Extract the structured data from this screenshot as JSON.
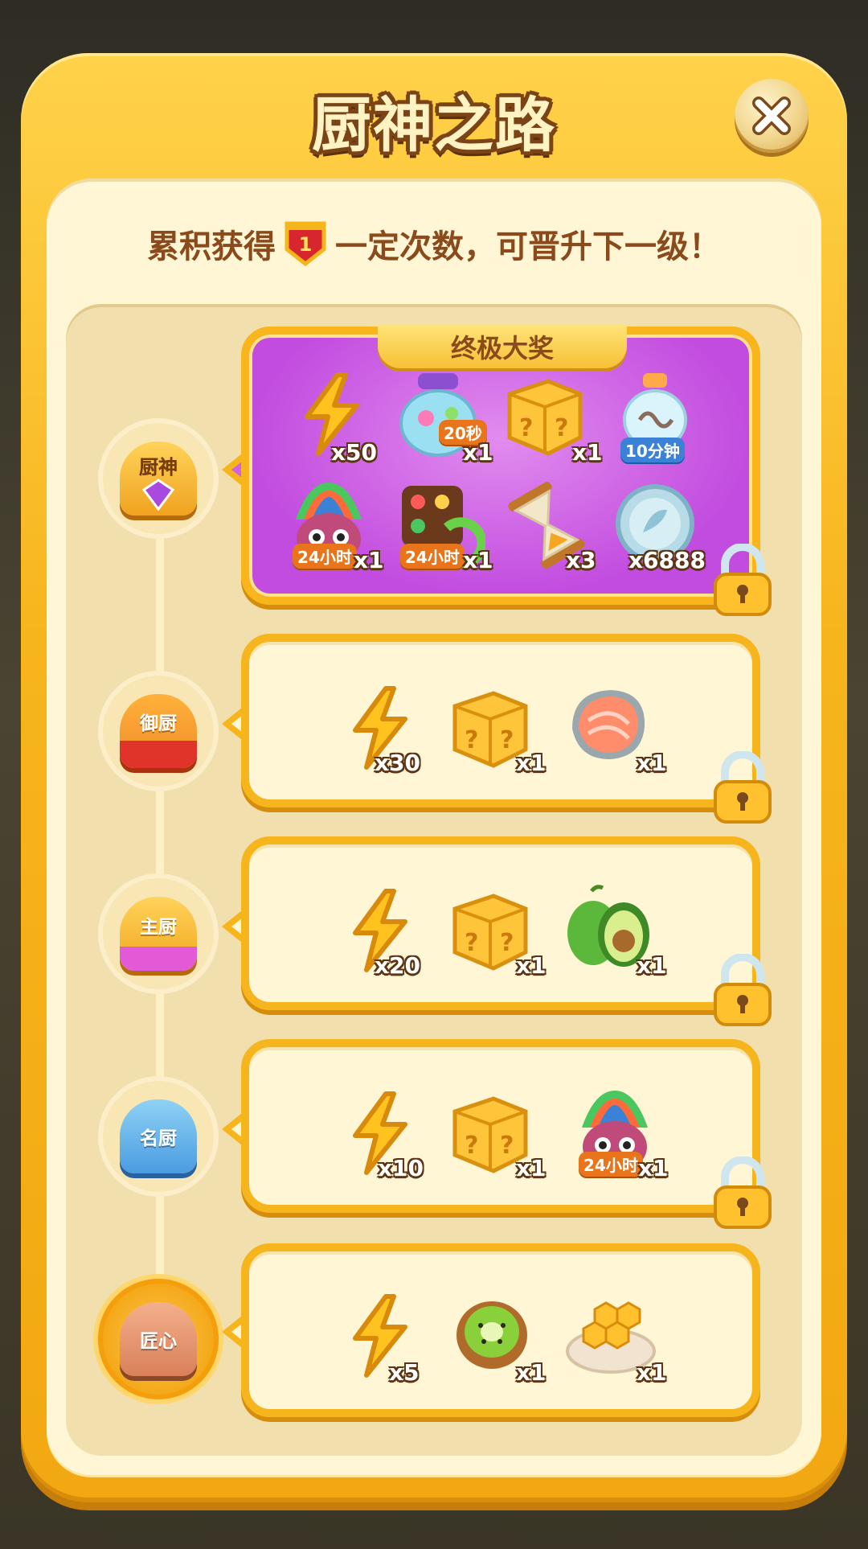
{
  "header": {
    "title": "厨神之路"
  },
  "subtitle": {
    "before": "累积获得",
    "token_number": "1",
    "after": "一定次数，可晋升下一级！"
  },
  "grand": {
    "banner": "终极大奖"
  },
  "tiers": [
    {
      "rank": "厨神",
      "locked": true,
      "items": [
        {
          "icon": "energy-bolt-icon",
          "qty": "x50"
        },
        {
          "icon": "candy-jar-icon",
          "qty": "x1",
          "tag": "20秒"
        },
        {
          "icon": "mystery-box-icon",
          "qty": "x1"
        },
        {
          "icon": "bottle-booster-icon",
          "qty": "",
          "tag": "10分钟"
        },
        {
          "icon": "owl-mask-icon",
          "qty": "x1",
          "tag": "24小时"
        },
        {
          "icon": "shuffle-board-icon",
          "qty": "x1",
          "tag": "24小时"
        },
        {
          "icon": "hourglass-icon",
          "qty": "x3"
        },
        {
          "icon": "silver-coin-icon",
          "qty": "x6888"
        }
      ]
    },
    {
      "rank": "御厨",
      "locked": true,
      "items": [
        {
          "icon": "energy-bolt-icon",
          "qty": "x30"
        },
        {
          "icon": "mystery-box-icon",
          "qty": "x1"
        },
        {
          "icon": "salmon-steak-icon",
          "qty": "x1"
        }
      ]
    },
    {
      "rank": "主厨",
      "locked": true,
      "items": [
        {
          "icon": "energy-bolt-icon",
          "qty": "x20"
        },
        {
          "icon": "mystery-box-icon",
          "qty": "x1"
        },
        {
          "icon": "avocado-icon",
          "qty": "x1"
        }
      ]
    },
    {
      "rank": "名厨",
      "locked": true,
      "items": [
        {
          "icon": "energy-bolt-icon",
          "qty": "x10"
        },
        {
          "icon": "mystery-box-icon",
          "qty": "x1"
        },
        {
          "icon": "owl-mask-icon",
          "qty": "x1",
          "tag": "24小时"
        }
      ]
    },
    {
      "rank": "匠心",
      "locked": false,
      "items": [
        {
          "icon": "energy-bolt-icon",
          "qty": "x5"
        },
        {
          "icon": "kiwi-icon",
          "qty": "x1"
        },
        {
          "icon": "honeycomb-plate-icon",
          "qty": "x1"
        }
      ]
    }
  ],
  "colors": {
    "panel": "#f7b51d",
    "cream": "#fff6d6",
    "brown_text": "#8a4a1c",
    "grand_purple": "#c24cdf"
  }
}
